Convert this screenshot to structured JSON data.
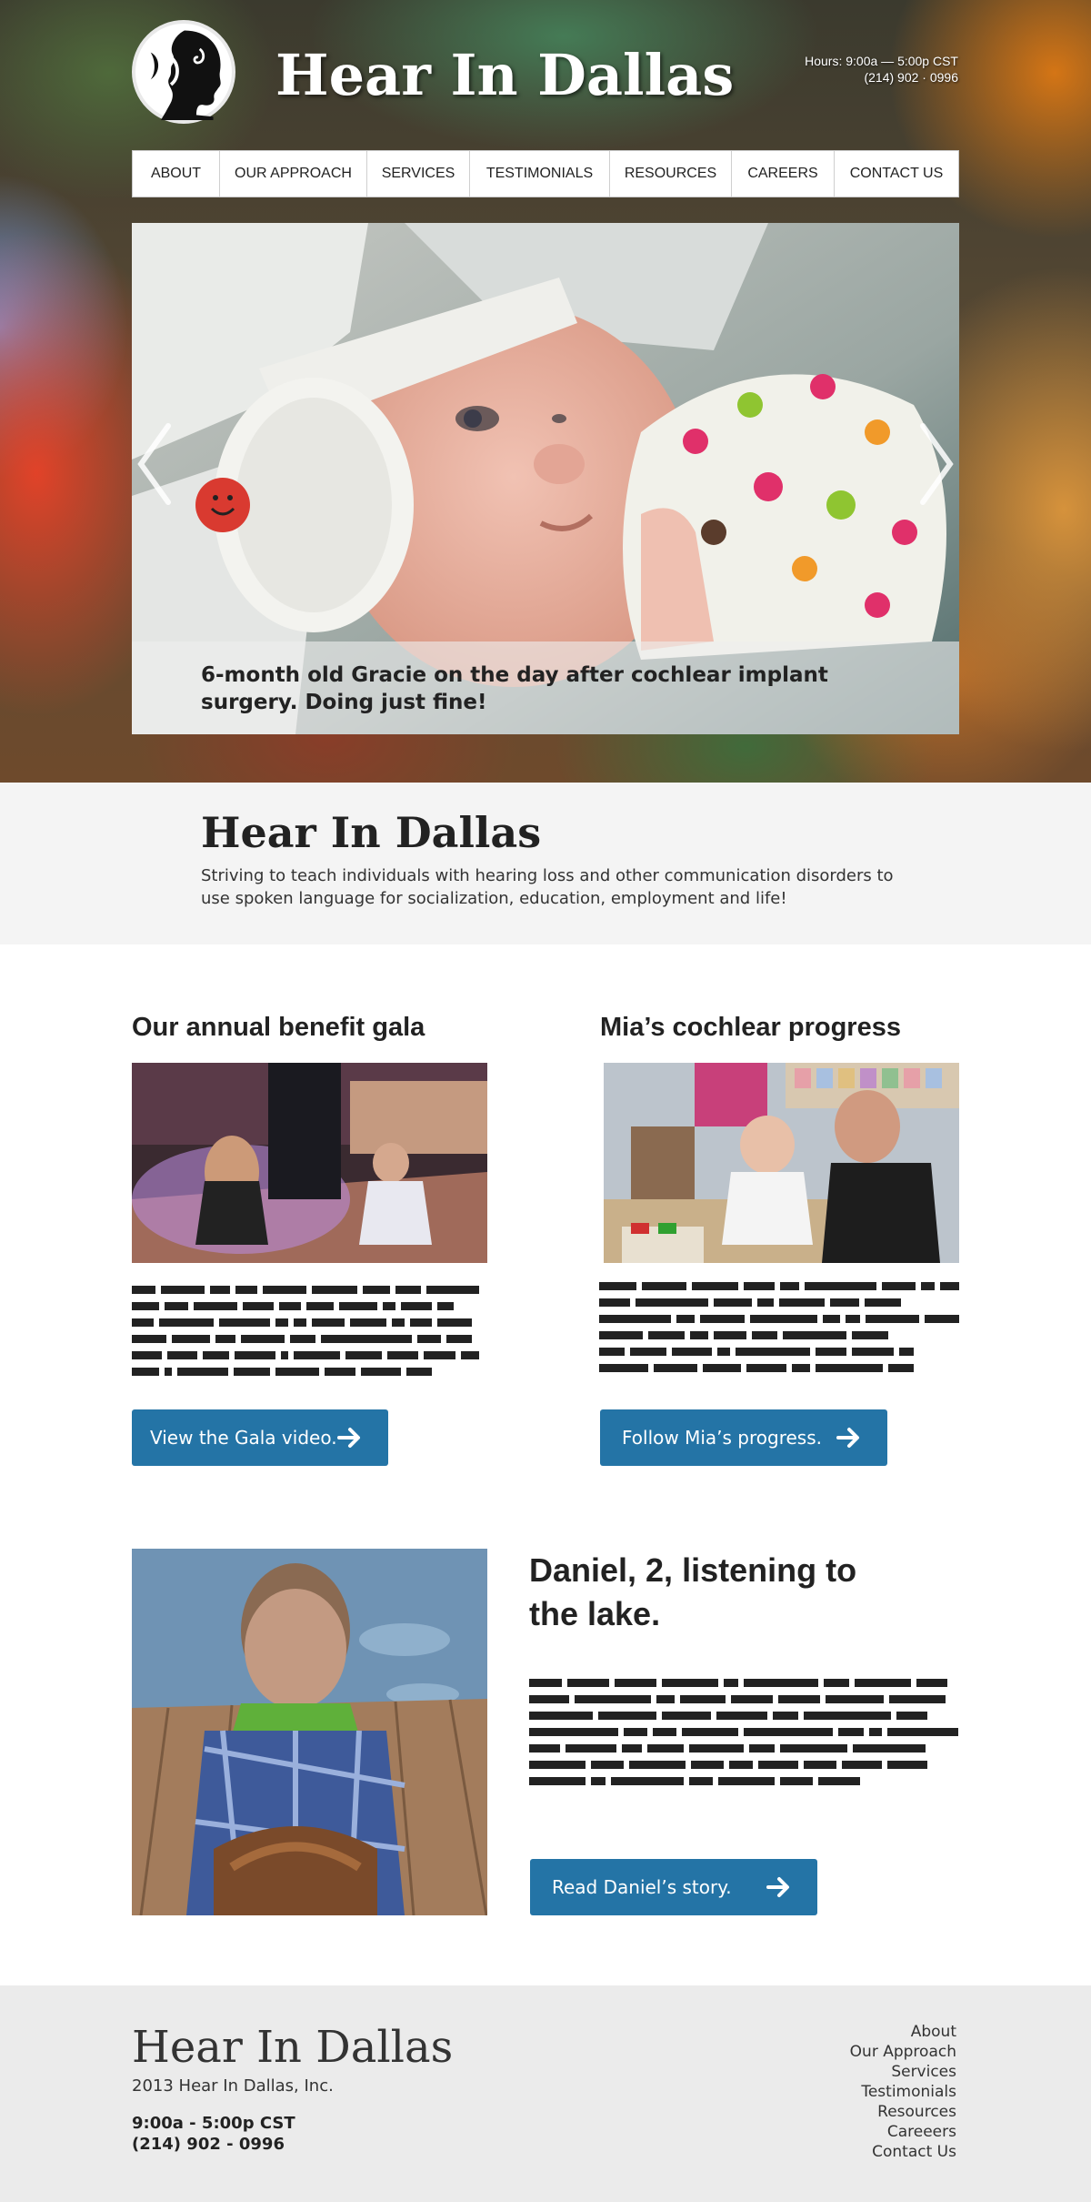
{
  "header": {
    "title": "Hear In Dallas",
    "hours": "Hours: 9:00a — 5:00p CST",
    "phone": "(214) 902 · 0996"
  },
  "nav": {
    "items": [
      {
        "label": "ABOUT"
      },
      {
        "label": "OUR APPROACH"
      },
      {
        "label": "SERVICES"
      },
      {
        "label": "TESTIMONIALS"
      },
      {
        "label": "RESOURCES"
      },
      {
        "label": "CAREERS"
      },
      {
        "label": "CONTACT US"
      }
    ]
  },
  "slider": {
    "caption": "6-month old Gracie on the day after cochlear implant surgery. Doing just fine!",
    "prev_icon": "chevron-left-icon",
    "next_icon": "chevron-right-icon"
  },
  "intro": {
    "title": "Hear In Dallas",
    "text": "Striving to teach individuals with hearing loss and other communication disorders to use spoken language for socialization, education, employment and life!"
  },
  "features": {
    "gala": {
      "title": "Our annual benefit gala",
      "button": "View the Gala video."
    },
    "mia": {
      "title": "Mia’s cochlear progress",
      "button": "Follow Mia’s progress."
    },
    "daniel": {
      "title": "Daniel, 2, listening to the lake.",
      "button": "Read Daniel’s story."
    }
  },
  "footer": {
    "title": "Hear In Dallas",
    "copyright": "2013 Hear In Dallas, Inc.",
    "hours": "9:00a - 5:00p CST",
    "phone": "(214) 902 - 0996",
    "links": [
      {
        "label": "About"
      },
      {
        "label": "Our Approach"
      },
      {
        "label": "Services"
      },
      {
        "label": "Testimonials"
      },
      {
        "label": "Resources"
      },
      {
        "label": "Careeers"
      },
      {
        "label": "Contact Us"
      }
    ]
  },
  "colors": {
    "button": "#2474a6",
    "text": "#222222",
    "intro_bg": "#f4f4f4",
    "footer_bg": "#ebebeb"
  }
}
